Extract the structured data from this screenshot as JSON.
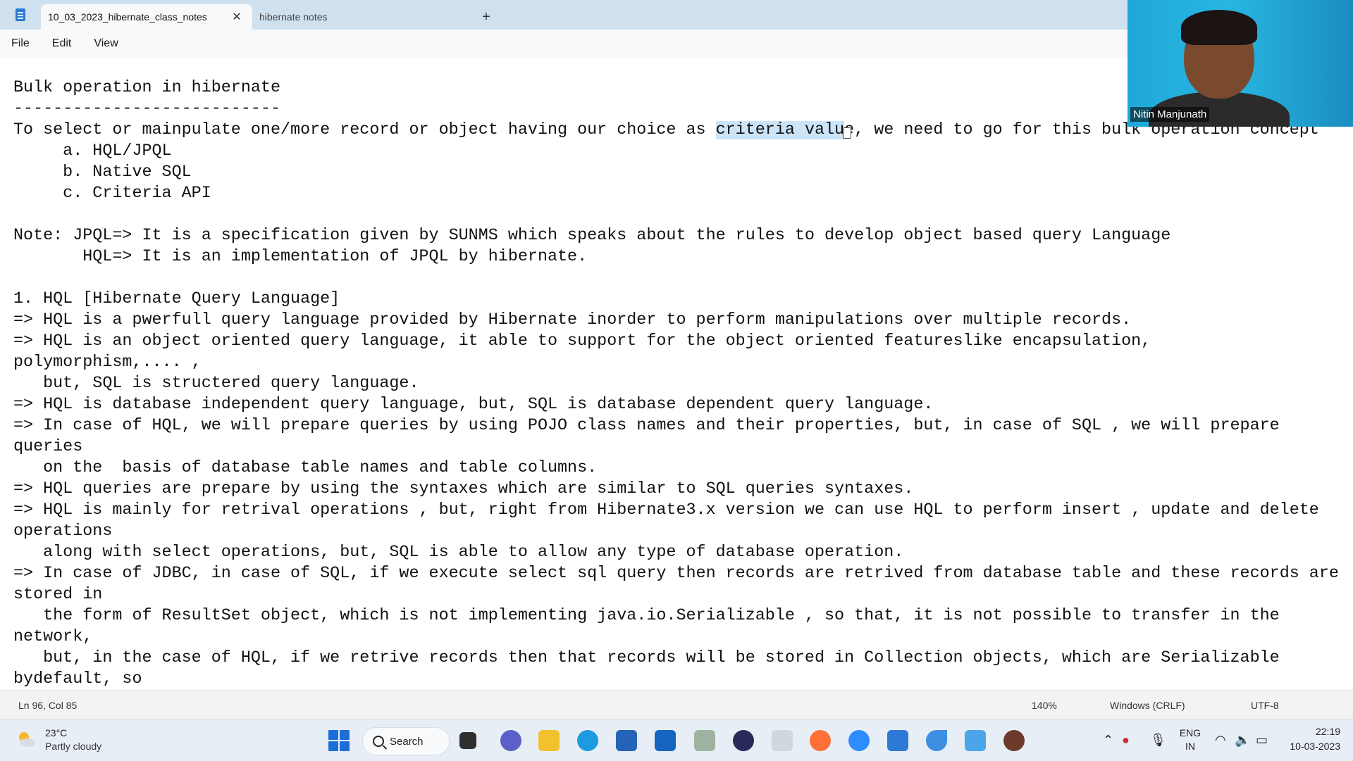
{
  "tabs": [
    {
      "label": "10_03_2023_hibernate_class_notes",
      "close": "✕"
    },
    {
      "label": "hibernate notes"
    }
  ],
  "add_tab": "+",
  "menu": [
    "File",
    "Edit",
    "View"
  ],
  "document": {
    "lines_before_sel": "Bulk operation in hibernate\n---------------------------\nTo select or mainpulate one/more record or object having our choice as ",
    "selection": "criteria valu",
    "lines_after_sel": "e, we need to go for this bulk operation concept\n     a. HQL/JPQL\n     b. Native SQL\n     c. Criteria API\n\nNote: JPQL=> It is a specification given by SUNMS which speaks about the rules to develop object based query Language\n       HQL=> It is an implementation of JPQL by hibernate.\n\n1. HQL [Hibernate Query Language]\n=> HQL is a pwerfull query language provided by Hibernate inorder to perform manipulations over multiple records.\n=> HQL is an object oriented query language, it able to support for the object oriented featureslike encapsulation,\npolymorphism,.... ,\n   but, SQL is structered query language.\n=> HQL is database independent query language, but, SQL is database dependent query language.\n=> In case of HQL, we will prepare queries by using POJO class names and their properties, but, in case of SQL , we will prepare\nqueries\n   on the  basis of database table names and table columns.\n=> HQL queries are prepare by using the syntaxes which are similar to SQL queries syntaxes.\n=> HQL is mainly for retrival operations , but, right from Hibernate3.x version we can use HQL to perform insert , update and delete\noperations\n   along with select operations, but, SQL is able to allow any type of database operation.\n=> In case of JDBC, in case of SQL, if we execute select sql query then records are retrived from database table and these records are\nstored in\n   the form of ResultSet object, which is not implementing java.io.Serializable , so that, it is not possible to transfer in the\nnetwork,\n   but, in the case of HQL, if we retrive records then that records will be stored in Collection objects, which are Serializable\nbydefault, so"
  },
  "status": {
    "position": "Ln 96, Col 85",
    "zoom": "140%",
    "line_ending": "Windows (CRLF)",
    "encoding": "UTF-8"
  },
  "video": {
    "participant": "Nitin Manjunath"
  },
  "taskbar": {
    "temperature": "23°C",
    "weather": "Partly cloudy",
    "search_label": "Search",
    "language_top": "ENG",
    "language_bottom": "IN",
    "time": "22:19",
    "date": "10-03-2023"
  },
  "colors": {
    "titlebar": "#cfe0ee",
    "selection": "#cce4f7",
    "taskbar": "#e8eef5"
  }
}
